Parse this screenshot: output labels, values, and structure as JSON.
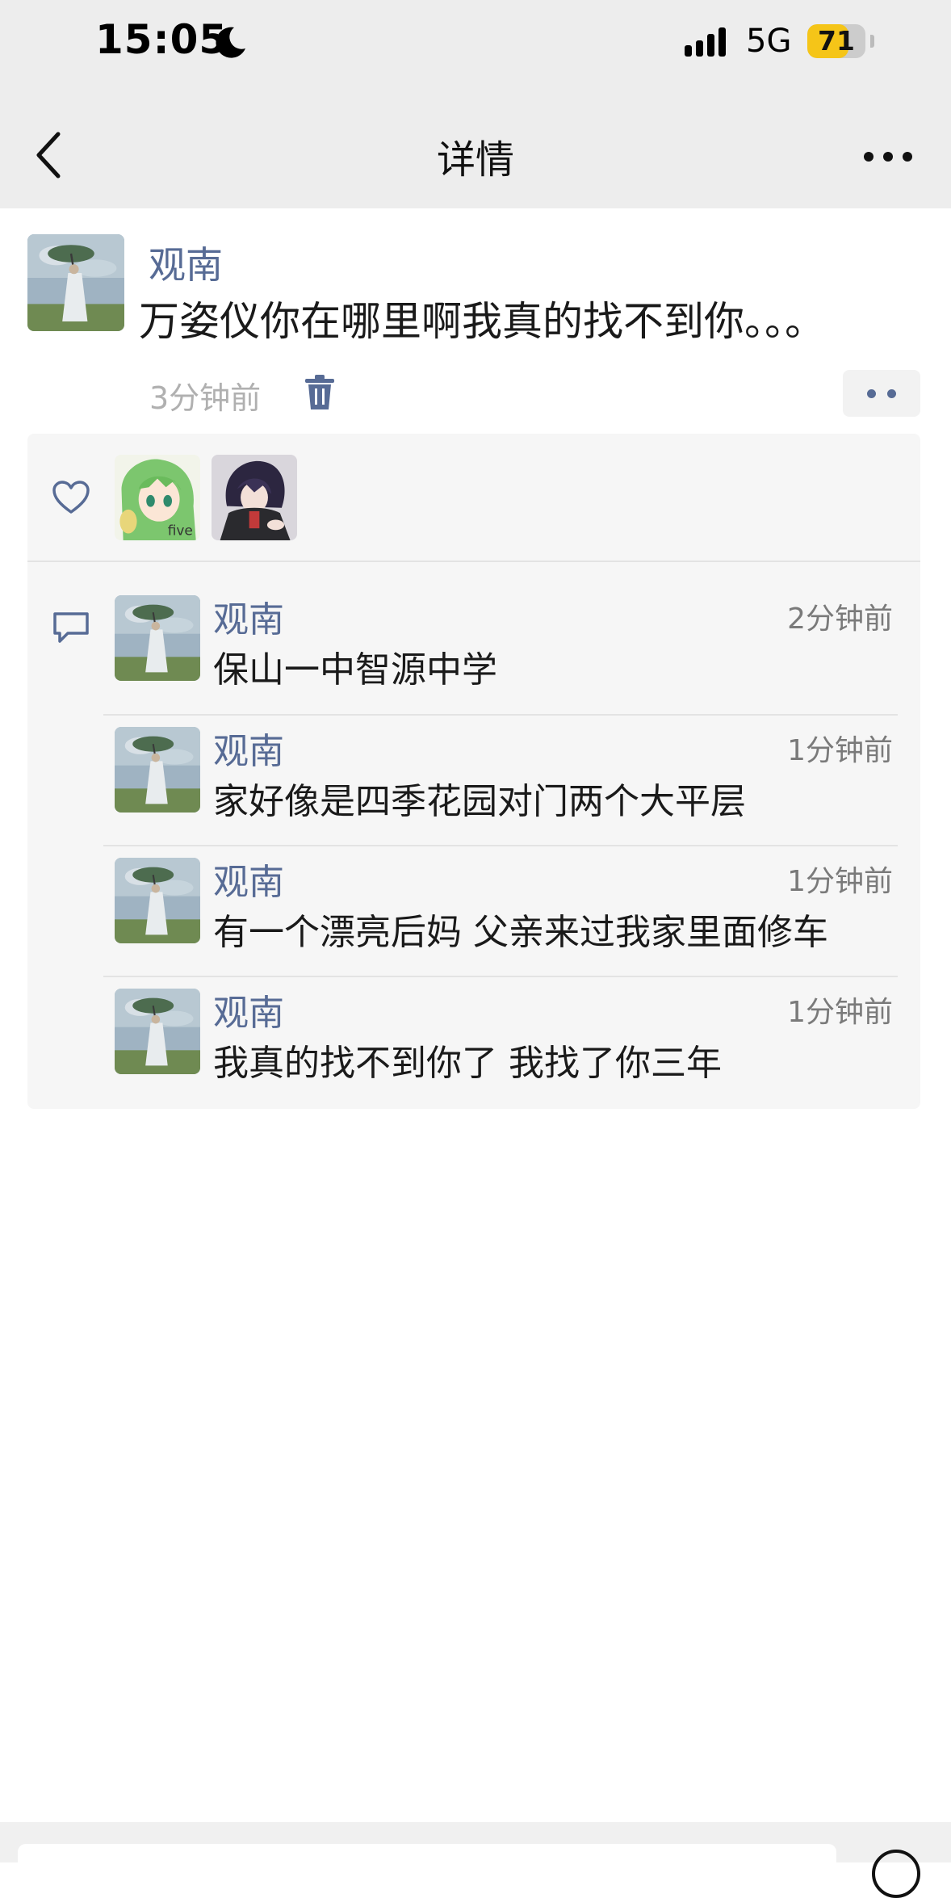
{
  "status_bar": {
    "time": "15:05",
    "network": "5G",
    "battery": "71",
    "battery_level": 0.71
  },
  "nav": {
    "title": "详情",
    "back_icon": "chevron-left-icon",
    "more_icon": "more-icon"
  },
  "post": {
    "author": "观南",
    "text": "万姿仪你在哪里啊我真的找不到你。。。",
    "time": "3分钟前",
    "delete_icon": "trash-icon",
    "action_icon": "comment-action-icon"
  },
  "likes": {
    "icon": "heart-icon",
    "users": [
      "like-user-1",
      "like-user-2"
    ],
    "avatar_caption": "five"
  },
  "comments": {
    "icon": "comment-icon",
    "items": [
      {
        "author": "观南",
        "time": "2分钟前",
        "text": "保山一中智源中学"
      },
      {
        "author": "观南",
        "time": "1分钟前",
        "text": "家好像是四季花园对门两个大平层"
      },
      {
        "author": "观南",
        "time": "1分钟前",
        "text": "有一个漂亮后妈 父亲来过我家里面修车"
      },
      {
        "author": "观南",
        "time": "1分钟前",
        "text": "我真的找不到你了 我找了你三年"
      }
    ]
  },
  "colors": {
    "link": "#576b95",
    "battery": "#f5c518",
    "nav_bg": "#ededed",
    "box_bg": "#f6f6f6"
  }
}
